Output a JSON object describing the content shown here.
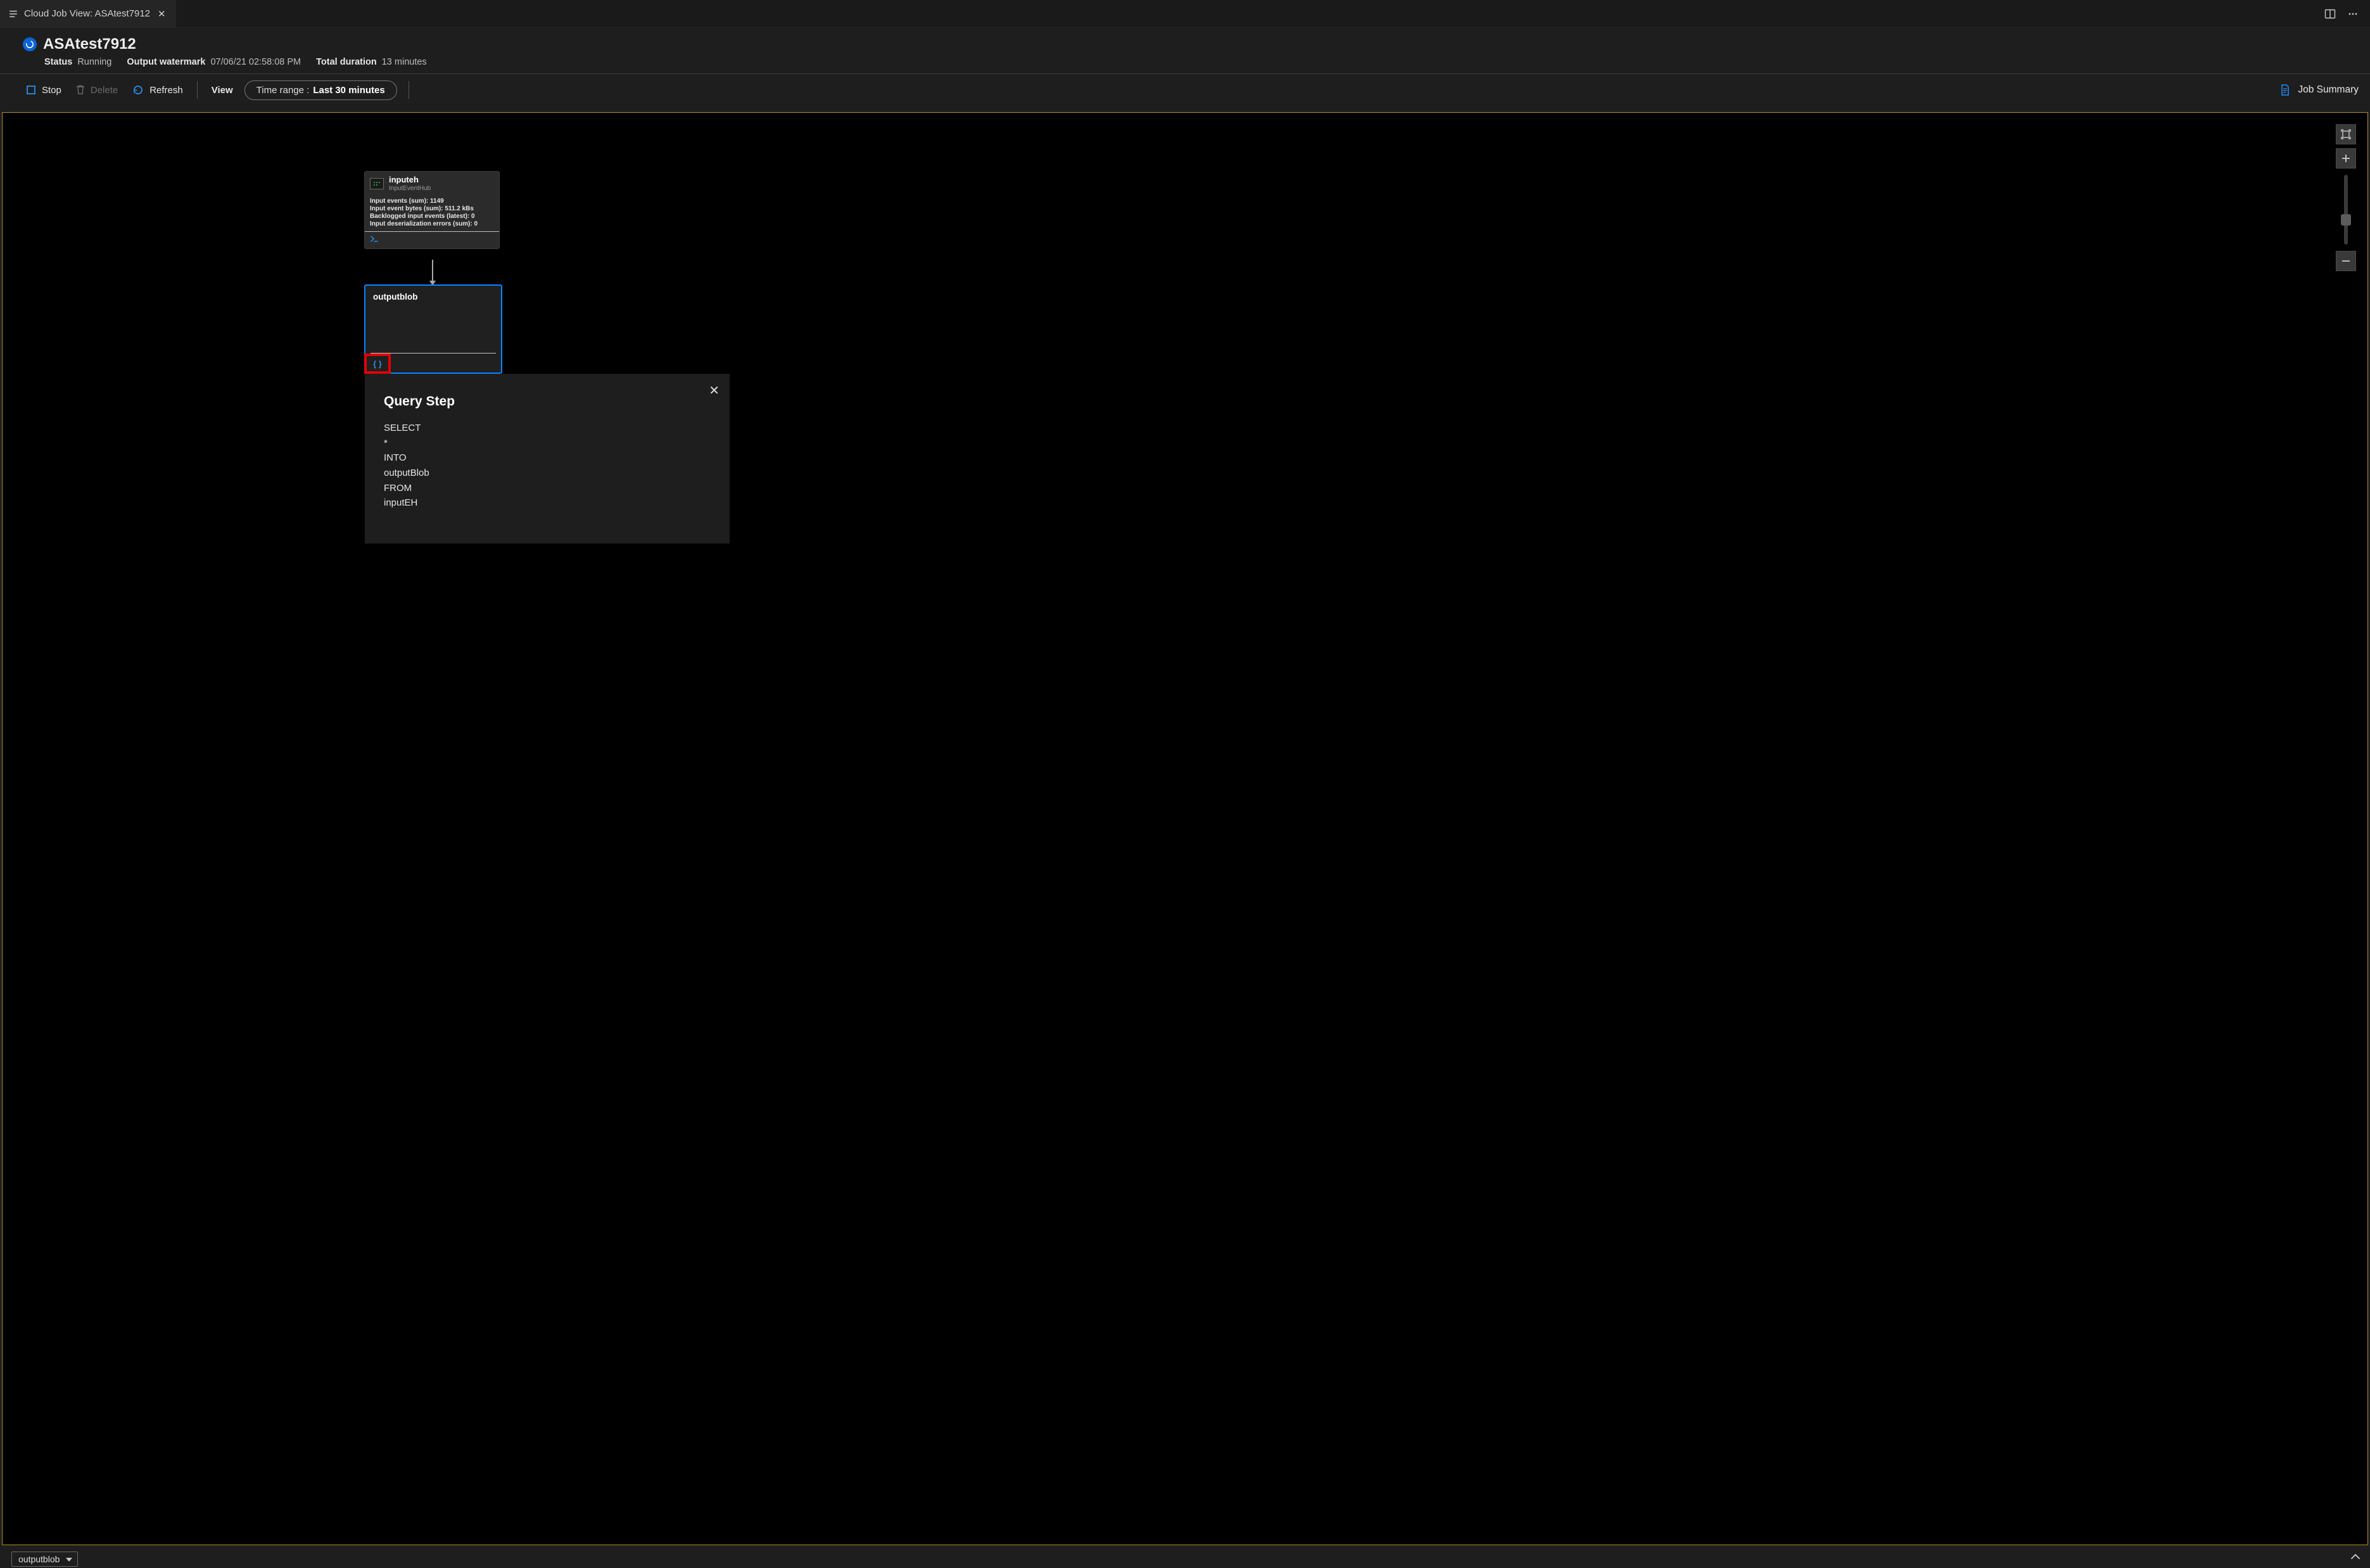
{
  "tab": {
    "title": "Cloud Job View: ASAtest7912"
  },
  "header": {
    "title": "ASAtest7912",
    "status_label": "Status",
    "status_value": "Running",
    "watermark_label": "Output watermark",
    "watermark_value": "07/06/21 02:58:08 PM",
    "duration_label": "Total duration",
    "duration_value": "13 minutes"
  },
  "toolbar": {
    "stop": "Stop",
    "delete": "Delete",
    "refresh": "Refresh",
    "view": "View",
    "timerange_label": "Time range :",
    "timerange_value": "Last 30 minutes",
    "job_summary": "Job Summary"
  },
  "nodes": {
    "input": {
      "title": "inputeh",
      "subtitle": "InputEventHub",
      "metric1_label": "Input events (sum):",
      "metric1_value": "1149",
      "metric2_label": "Input event bytes (sum):",
      "metric2_value": "511.2 kBs",
      "metric3_label": "Backlogged input events (latest):",
      "metric3_value": "0",
      "metric4_label": "Input deserialization errors (sum):",
      "metric4_value": "0"
    },
    "output": {
      "title": "outputblob",
      "script_glyph": "{ }"
    }
  },
  "popup": {
    "title": "Query Step",
    "lines": [
      "SELECT",
      "*",
      "INTO",
      "outputBlob",
      "FROM",
      "inputEH"
    ]
  },
  "bottom": {
    "dropdown_label": "outputblob"
  },
  "colors": {
    "accent": "#0a84ff",
    "canvas_border": "#b58b2d",
    "highlight": "#e40000"
  }
}
